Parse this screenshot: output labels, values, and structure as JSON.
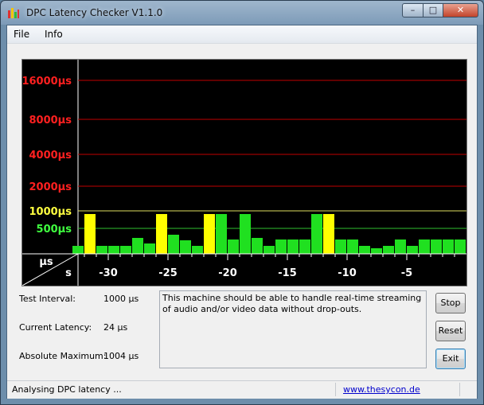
{
  "window": {
    "title": "DPC Latency Checker V1.1.0"
  },
  "menu": {
    "items": [
      "File",
      "Info"
    ]
  },
  "graph": {
    "y_unit": "µs",
    "x_unit": "s",
    "y_labels": [
      {
        "text": "16000µs",
        "color": "#ff2020"
      },
      {
        "text": "8000µs",
        "color": "#ff2020"
      },
      {
        "text": "4000µs",
        "color": "#ff2020"
      },
      {
        "text": "2000µs",
        "color": "#ff2020"
      },
      {
        "text": "1000µs",
        "color": "#ffff40"
      },
      {
        "text": "500µs",
        "color": "#40ff40"
      }
    ],
    "x_labels": [
      "-30",
      "-25",
      "-20",
      "-15",
      "-10",
      "-5"
    ],
    "bar_colors": {
      "green": "#20e020",
      "yellow": "#ffff00"
    },
    "bars": [
      {
        "t": -33,
        "v": 1,
        "c": "green"
      },
      {
        "t": -32,
        "v": 5,
        "c": "yellow"
      },
      {
        "t": -31,
        "v": 1,
        "c": "green"
      },
      {
        "t": -30,
        "v": 1,
        "c": "green"
      },
      {
        "t": -29,
        "v": 1,
        "c": "green"
      },
      {
        "t": -28,
        "v": 2,
        "c": "green"
      },
      {
        "t": -27,
        "v": 1.3,
        "c": "green"
      },
      {
        "t": -26,
        "v": 5,
        "c": "yellow"
      },
      {
        "t": -25,
        "v": 2.4,
        "c": "green"
      },
      {
        "t": -24,
        "v": 1.7,
        "c": "green"
      },
      {
        "t": -23,
        "v": 1,
        "c": "green"
      },
      {
        "t": -22,
        "v": 5,
        "c": "yellow"
      },
      {
        "t": -21,
        "v": 5,
        "c": "green"
      },
      {
        "t": -20,
        "v": 1.8,
        "c": "green"
      },
      {
        "t": -19,
        "v": 5,
        "c": "green"
      },
      {
        "t": -18,
        "v": 2,
        "c": "green"
      },
      {
        "t": -17,
        "v": 1,
        "c": "green"
      },
      {
        "t": -16,
        "v": 1.8,
        "c": "green"
      },
      {
        "t": -15,
        "v": 1.8,
        "c": "green"
      },
      {
        "t": -14,
        "v": 1.8,
        "c": "green"
      },
      {
        "t": -13,
        "v": 5,
        "c": "green"
      },
      {
        "t": -12,
        "v": 5,
        "c": "yellow"
      },
      {
        "t": -11,
        "v": 1.8,
        "c": "green"
      },
      {
        "t": -10,
        "v": 1.8,
        "c": "green"
      },
      {
        "t": -9,
        "v": 1,
        "c": "green"
      },
      {
        "t": -8,
        "v": 0.7,
        "c": "green"
      },
      {
        "t": -7,
        "v": 1,
        "c": "green"
      },
      {
        "t": -6,
        "v": 1.8,
        "c": "green"
      },
      {
        "t": -5,
        "v": 1,
        "c": "green"
      },
      {
        "t": -4,
        "v": 1.8,
        "c": "green"
      },
      {
        "t": -3,
        "v": 1.8,
        "c": "green"
      },
      {
        "t": -2,
        "v": 1.8,
        "c": "green"
      },
      {
        "t": -1,
        "v": 1.8,
        "c": "green"
      }
    ]
  },
  "info": {
    "test_interval_label": "Test Interval:",
    "test_interval_value": "1000 µs",
    "current_latency_label": "Current Latency:",
    "current_latency_value": "24 µs",
    "absolute_max_label": "Absolute Maximum:",
    "absolute_max_value": "1004 µs"
  },
  "message": "This machine should be able to handle real-time streaming of audio and/or video data without drop-outs.",
  "buttons": {
    "stop": "Stop",
    "reset": "Reset",
    "exit": "Exit"
  },
  "status": {
    "text": "Analysing DPC latency ...",
    "link": "www.thesycon.de"
  }
}
